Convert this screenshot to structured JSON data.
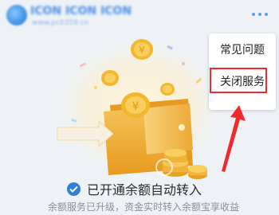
{
  "header": {
    "site_name": "ICON ICON ICON",
    "site_url": "www.pc0359.cn",
    "more_icon": "more-dots-icon"
  },
  "menu": {
    "items": [
      {
        "label": "常见问题"
      },
      {
        "label": "关闭服务"
      }
    ]
  },
  "annotation": {
    "highlight_color": "#ee2a2a",
    "arrow_color": "#ee2a2a"
  },
  "status": {
    "title": "已开通余额自动转入",
    "subtitle": "余额服务已升级，资金实时转入余额宝享收益"
  },
  "colors": {
    "accent": "#2d7fe0",
    "gold": "#f2b328"
  }
}
